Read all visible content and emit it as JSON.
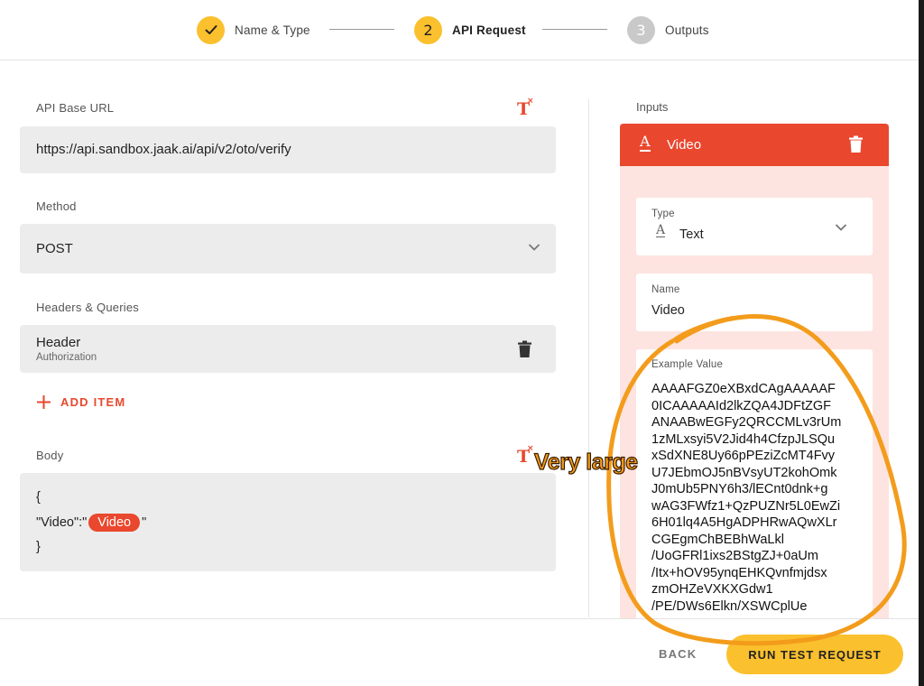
{
  "stepper": {
    "steps": [
      {
        "number": "✓",
        "label": "Name & Type",
        "state": "done"
      },
      {
        "number": "2",
        "label": "API Request",
        "state": "active"
      },
      {
        "number": "3",
        "label": "Outputs",
        "state": "pending"
      }
    ]
  },
  "form": {
    "base_url_label": "API Base URL",
    "base_url_value": "https://api.sandbox.jaak.ai/api/v2/oto/verify",
    "method_label": "Method",
    "method_value": "POST",
    "headers_label": "Headers & Queries",
    "header_item": {
      "type": "Header",
      "name": "Authorization"
    },
    "add_item_label": "ADD ITEM",
    "body_label": "Body",
    "body_open": "{",
    "body_key": "\"Video\":\"",
    "body_chip": "Video",
    "body_quote_close": "\"",
    "body_close": "}"
  },
  "inputs_panel": {
    "title": "Inputs",
    "input_name": "Video",
    "type_label": "Type",
    "type_value": "Text",
    "name_label": "Name",
    "name_value": "Video",
    "example_label": "Example Value",
    "example_lines": [
      "AAAAFGZ0eXBxdCAgAAAAAF",
      "0ICAAAAAId2lkZQA4JDFtZGF",
      "ANAABwEGFy2QRCCMLv3rUm",
      "1zMLxsyi5V2Jid4h4CfzpJLSQu",
      "xSdXNE8Uy66pPEziZcMT4Fvy",
      "U7JEbmOJ5nBVsyUT2kohOmk",
      "J0mUb5PNY6h3/lECnt0dnk+g",
      "wAG3FWfz1+QzPUZNr5L0EwZi",
      "6H01lq4A5HgADPHRwAQwXLr",
      "CGEgmChBEBhWaLkl",
      "/UoGFRl1ixs2BStgZJ+0aUm",
      "/Itx+hOV95ynqEHKQvnfmjdsx",
      "zmOHZeVXKXGdw1",
      "/PE/DWs6Elkn/XSWCplUe"
    ]
  },
  "footer": {
    "back_label": "BACK",
    "run_label": "RUN TEST REQUEST"
  },
  "annotation": {
    "text": "Very large"
  },
  "colors": {
    "accent_red": "#e9472e",
    "accent_yellow": "#fbc02d",
    "panel_pink": "#fde4e0",
    "annotation_orange": "#f39c1c"
  }
}
